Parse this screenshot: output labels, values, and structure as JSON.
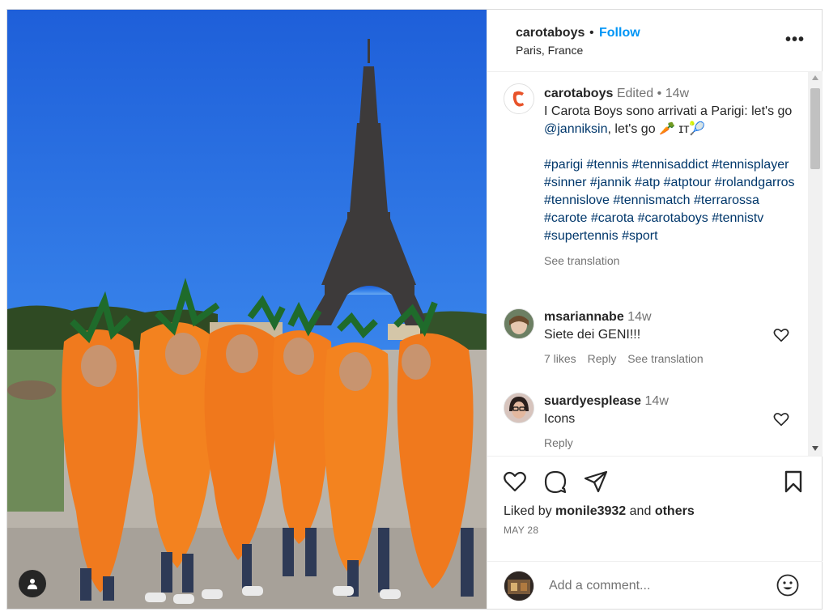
{
  "post": {
    "username": "carotaboys",
    "follow_label": "Follow",
    "separator": "•",
    "location": "Paris, France",
    "more_label": "•••"
  },
  "caption": {
    "username": "carotaboys",
    "edited": "Edited",
    "time": "14w",
    "text_before": "I Carota Boys sono arrivati a Parigi: let's go ",
    "mention": "@janniksin",
    "text_after": ", let's go 🥕 ɪᴛ🎾",
    "hashtags": "#parigi #tennis #tennisaddict #tennisplayer #sinner #jannik #atp #atptour #rolandgarros #tennislove #tennismatch #terrarossa #carote #carota #carotaboys #tennistv #supertennis #sport",
    "see_translation": "See translation"
  },
  "comments": [
    {
      "username": "msariannabe",
      "time": "14w",
      "text": "Siete dei GENI!!!",
      "likes": "7 likes",
      "reply": "Reply",
      "see_translation": "See translation"
    },
    {
      "username": "suardyesplease",
      "time": "14w",
      "text": "Icons",
      "reply": "Reply"
    }
  ],
  "actions": {
    "liked_by_prefix": "Liked by",
    "liked_by_user": "monile3932",
    "liked_by_and": "and",
    "liked_by_others": "others",
    "date": "MAY 28"
  },
  "add_comment": {
    "placeholder": "Add a comment..."
  },
  "icons": {
    "like": "heart-icon",
    "comment": "comment-bubble-icon",
    "share": "paper-plane-icon",
    "save": "bookmark-icon",
    "emoji": "smiley-icon",
    "tag": "user-tag-icon",
    "more": "more-options-icon"
  },
  "colors": {
    "accent": "#0095f6",
    "link": "#00376b",
    "text": "#262626",
    "muted": "#737373"
  }
}
